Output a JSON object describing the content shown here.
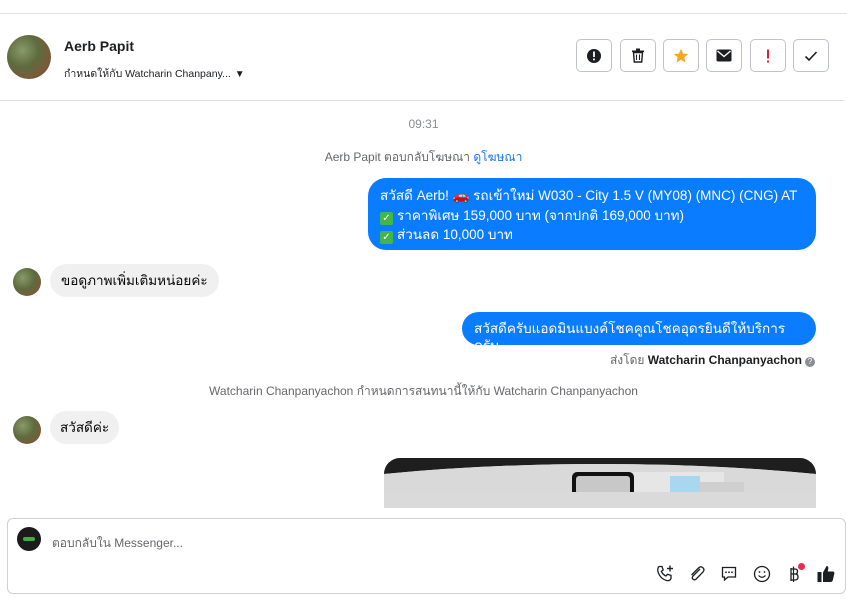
{
  "header": {
    "name": "Aerb Papit",
    "assigned_to": "กำหนดให้กับ Watcharin Chanpany...",
    "actions": [
      "spam-report",
      "delete",
      "star",
      "mark-unread",
      "important",
      "done"
    ]
  },
  "thread": {
    "time": "09:31",
    "ad_reply": {
      "text": "Aerb Papit ตอบกลับโฆษณา ",
      "link": "ดูโฆษณา"
    },
    "out1": {
      "line1": "สวัสดี Aerb! 🚗 รถเข้าใหม่ W030 - City 1.5 V (MY08) (MNC) (CNG) AT",
      "line2": "ราคาพิเศษ 159,000 บาท (จากปกติ 169,000 บาท)",
      "line3": "ส่วนลด 10,000 บาท"
    },
    "in1": "ขอดูภาพเพิ่มเติมหน่อยค่ะ",
    "out2": "สวัสดีครับแอดมินแบงค์โชคคูณโชคอุดรยินดีให้บริการครับ",
    "sent_by": {
      "prefix": "ส่งโดย ",
      "name": "Watcharin Chanpanyachon"
    },
    "assign_note": "Watcharin Chanpanyachon กำหนดการสนทนานี้ให้กับ Watcharin Chanpanyachon",
    "in2": "สวัสดีค่ะ"
  },
  "composer": {
    "placeholder": "ตอบกลับใน Messenger..."
  },
  "colors": {
    "accent": "#0a7cff",
    "star": "#f5a623",
    "important": "#e41e3f",
    "check": "#43b649"
  }
}
